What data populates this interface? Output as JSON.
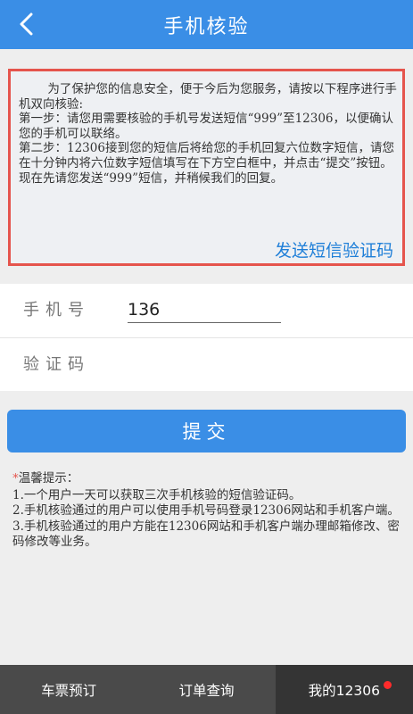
{
  "header": {
    "title": "手机核验"
  },
  "notice": {
    "intro": "为了保护您的信息安全，便于今后为您服务，请按以下程序进行手机双向核验:",
    "step1": "第一步：请您用需要核验的手机号发送短信“999”至12306，以便确认您的手机可以联络。",
    "step2": "第二步：12306接到您的短信后将给您的手机回复六位数字短信，请您在十分钟内将六位数字短信填写在下方空白框中，并点击“提交”按钮。 现在先请您发送“999”短信，并稍候我们的回复。",
    "sms_link": "发送短信验证码"
  },
  "form": {
    "phone_label": "手机号",
    "phone_value": "136",
    "code_label": "验证码",
    "code_value": ""
  },
  "submit_label": "提交",
  "tips": {
    "star": "*",
    "title": "温馨提示：",
    "items": [
      "1.一个用户一天可以获取三次手机核验的短信验证码。",
      "2.手机核验通过的用户可以使用手机号码登录12306网站和手机客户端。",
      "3.手机核验通过的用户方能在12306网站和手机客户端办理邮箱修改、密码修改等业务。"
    ]
  },
  "tabbar": {
    "items": [
      {
        "label": "车票预订"
      },
      {
        "label": "订单查询"
      },
      {
        "label": "我的12306"
      }
    ]
  },
  "colors": {
    "brand_blue": "#3a8ee6",
    "notice_border": "#e5544c",
    "link_blue": "#1f7fd8",
    "tabbar_bg": "#4a4a4a",
    "badge_red": "#ff2b2b"
  }
}
